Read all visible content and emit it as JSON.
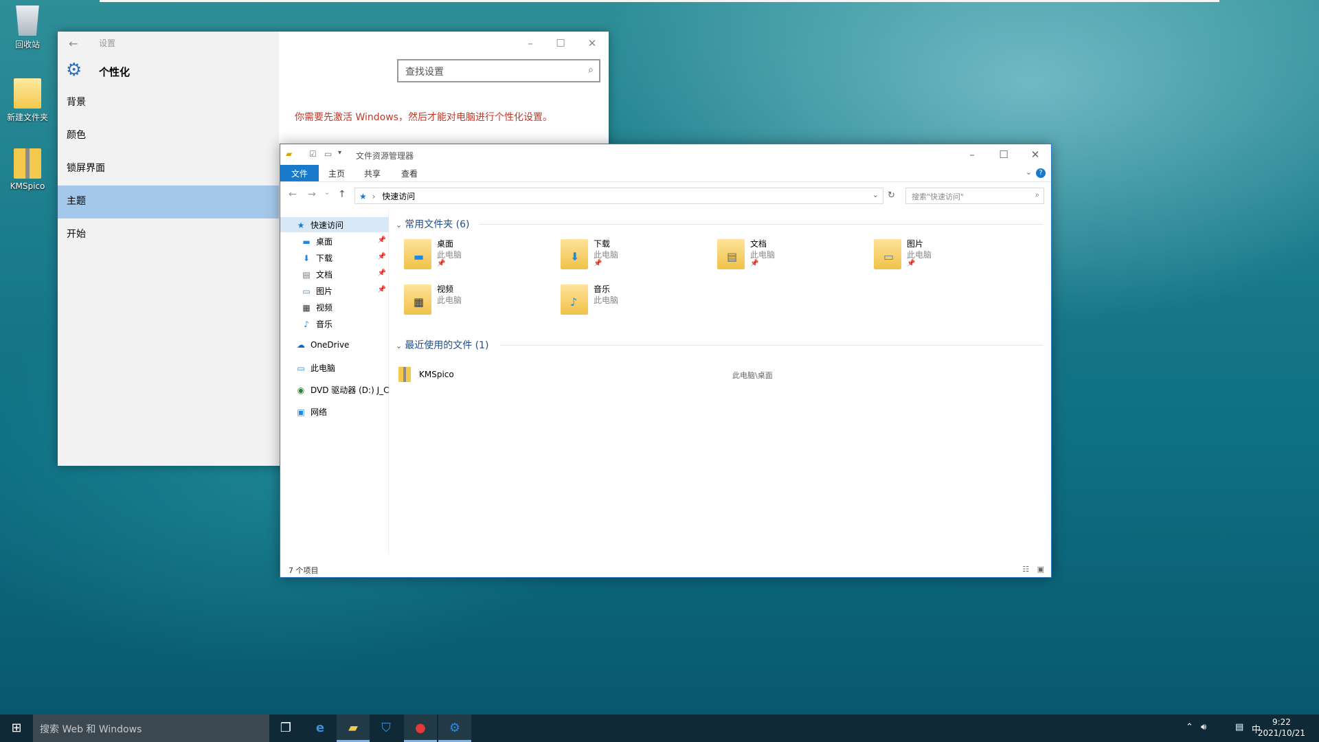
{
  "desktop": {
    "icons": [
      {
        "label": "回收站",
        "icon": "recycle-bin-icon"
      },
      {
        "label": "新建文件夹",
        "icon": "folder-icon"
      },
      {
        "label": "KMSpico",
        "icon": "zip-folder-icon"
      }
    ]
  },
  "settings": {
    "title": "设置",
    "heading": "个性化",
    "search_placeholder": "查找设置",
    "nav": [
      "背景",
      "颜色",
      "锁屏界面",
      "主题",
      "开始"
    ],
    "selected": "主题",
    "warning": "你需要先激活 Windows，然后才能对电脑进行个性化设置。"
  },
  "explorer": {
    "title": "文件资源管理器",
    "tabs": [
      "文件",
      "主页",
      "共享",
      "查看"
    ],
    "address": "快速访问",
    "search_placeholder": "搜索\"快速访问\"",
    "nav": {
      "quick_access": "快速访问",
      "pinned": [
        {
          "label": "桌面",
          "pinned": true
        },
        {
          "label": "下载",
          "pinned": true
        },
        {
          "label": "文档",
          "pinned": true
        },
        {
          "label": "图片",
          "pinned": true
        },
        {
          "label": "视频",
          "pinned": false
        },
        {
          "label": "音乐",
          "pinned": false
        }
      ],
      "onedrive": "OneDrive",
      "this_pc": "此电脑",
      "dvd": "DVD 驱动器 (D:) J_C",
      "network": "网络"
    },
    "frequent_header": "常用文件夹 (6)",
    "folders": [
      {
        "name": "桌面",
        "location": "此电脑",
        "pinned": true
      },
      {
        "name": "下载",
        "location": "此电脑",
        "pinned": true
      },
      {
        "name": "文档",
        "location": "此电脑",
        "pinned": true
      },
      {
        "name": "图片",
        "location": "此电脑",
        "pinned": true
      },
      {
        "name": "视频",
        "location": "此电脑",
        "pinned": false
      },
      {
        "name": "音乐",
        "location": "此电脑",
        "pinned": false
      }
    ],
    "recent_header": "最近使用的文件 (1)",
    "recent": [
      {
        "name": "KMSpico",
        "path": "此电脑\\桌面"
      }
    ],
    "status": "7 个项目"
  },
  "taskbar": {
    "search_placeholder": "搜索 Web 和 Windows",
    "ime": "中",
    "time": "9:22",
    "date": "2021/10/21"
  }
}
